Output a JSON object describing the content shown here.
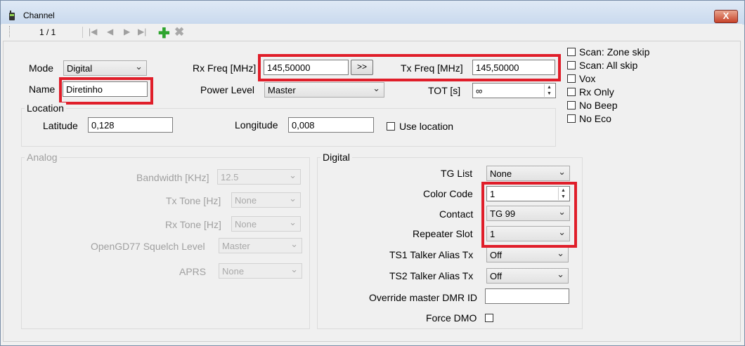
{
  "window": {
    "title": "Channel",
    "close_label": "X"
  },
  "toolbar": {
    "page_count": "1 / 1",
    "first": "|◀",
    "prev": "◀",
    "next": "▶",
    "last": "▶|",
    "add": "✚",
    "delete": "✖"
  },
  "main": {
    "mode_label": "Mode",
    "mode_value": "Digital",
    "name_label": "Name",
    "name_value": "Diretinho",
    "rx_freq_label": "Rx Freq [MHz]",
    "rx_freq_value": "145,50000",
    "copy_button": ">>",
    "tx_freq_label": "Tx Freq [MHz]",
    "tx_freq_value": "145,50000",
    "power_level_label": "Power Level",
    "power_level_value": "Master",
    "tot_label": "TOT [s]",
    "tot_value": "∞"
  },
  "options": [
    {
      "label": "Scan: Zone skip",
      "checked": false
    },
    {
      "label": "Scan: All skip",
      "checked": false
    },
    {
      "label": "Vox",
      "checked": false
    },
    {
      "label": "Rx Only",
      "checked": false
    },
    {
      "label": "No Beep",
      "checked": false
    },
    {
      "label": "No Eco",
      "checked": false
    }
  ],
  "location": {
    "group_label": "Location",
    "latitude_label": "Latitude",
    "latitude_value": "0,128",
    "longitude_label": "Longitude",
    "longitude_value": "0,008",
    "use_location_label": "Use location"
  },
  "analog": {
    "group_label": "Analog",
    "bandwidth_label": "Bandwidth [KHz]",
    "bandwidth_value": "12.5",
    "tx_tone_label": "Tx Tone [Hz]",
    "tx_tone_value": "None",
    "rx_tone_label": "Rx Tone [Hz]",
    "rx_tone_value": "None",
    "squelch_label": "OpenGD77 Squelch Level",
    "squelch_value": "Master",
    "aprs_label": "APRS",
    "aprs_value": "None"
  },
  "digital": {
    "group_label": "Digital",
    "tg_list_label": "TG List",
    "tg_list_value": "None",
    "color_code_label": "Color Code",
    "color_code_value": "1",
    "contact_label": "Contact",
    "contact_value": "TG 99",
    "repeater_slot_label": "Repeater Slot",
    "repeater_slot_value": "1",
    "ts1_label": "TS1 Talker Alias Tx",
    "ts1_value": "Off",
    "ts2_label": "TS2 Talker Alias Tx",
    "ts2_value": "Off",
    "override_label": "Override master DMR ID",
    "override_value": "",
    "force_dmo_label": "Force DMO"
  },
  "colors": {
    "highlight": "#e01e2a",
    "title_bar": "#c9d9ee",
    "close": "#c7432a",
    "add": "#2fa52f"
  }
}
